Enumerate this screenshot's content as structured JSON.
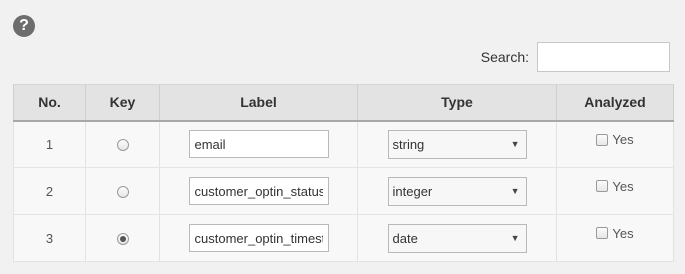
{
  "help": {
    "glyph": "?"
  },
  "search": {
    "label": "Search:",
    "value": ""
  },
  "columns": [
    "No.",
    "Key",
    "Label",
    "Type",
    "Analyzed"
  ],
  "rows": [
    {
      "no": "1",
      "key_selected": false,
      "label": "email",
      "type": "string",
      "analyzed_checked": false,
      "analyzed_label": "Yes"
    },
    {
      "no": "2",
      "key_selected": false,
      "label": "customer_optin_status",
      "type": "integer",
      "analyzed_checked": false,
      "analyzed_label": "Yes"
    },
    {
      "no": "3",
      "key_selected": true,
      "label": "customer_optin_timestamp",
      "type": "date",
      "analyzed_checked": false,
      "analyzed_label": "Yes"
    }
  ]
}
